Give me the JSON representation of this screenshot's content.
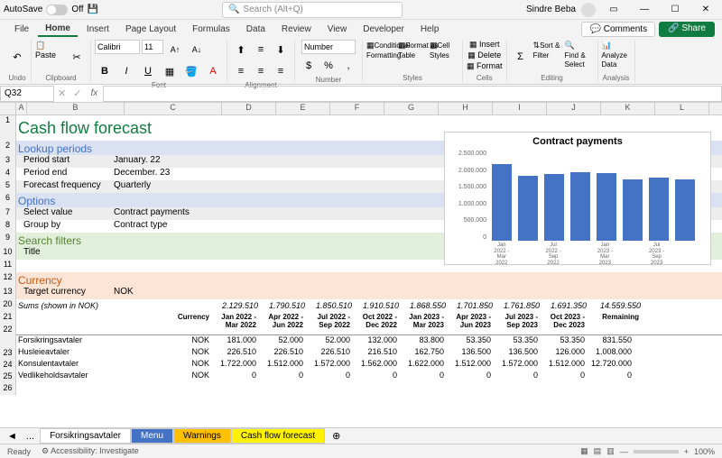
{
  "titlebar": {
    "autosave": "AutoSave",
    "off": "Off",
    "search": "Search (Alt+Q)",
    "user": "Sindre Beba"
  },
  "menu": {
    "file": "File",
    "home": "Home",
    "insert": "Insert",
    "pagelayout": "Page Layout",
    "formulas": "Formulas",
    "data": "Data",
    "review": "Review",
    "view": "View",
    "developer": "Developer",
    "help": "Help",
    "comments": "Comments",
    "share": "Share"
  },
  "ribbon": {
    "undo": "Undo",
    "clipboard": "Clipboard",
    "paste": "Paste",
    "font": "Font",
    "fontname": "Calibri",
    "fontsize": "11",
    "alignment": "Alignment",
    "number": "Number",
    "numfmt": "Number",
    "styles": "Styles",
    "condfmt": "Conditional\nFormatting",
    "fmttable": "Format as\nTable",
    "cellstyles": "Cell\nStyles",
    "cells": "Cells",
    "insert": "Insert",
    "delete": "Delete",
    "format": "Format",
    "editing": "Editing",
    "sort": "Sort &\nFilter",
    "find": "Find &\nSelect",
    "analysis": "Analysis",
    "analyze": "Analyze\nData"
  },
  "namebox": "Q32",
  "cols": [
    "A",
    "B",
    "C",
    "D",
    "E",
    "F",
    "G",
    "H",
    "I",
    "J",
    "K",
    "L"
  ],
  "sheet": {
    "title": "Cash flow forecast",
    "sec1": "Lookup periods",
    "period_start_lbl": "Period start",
    "period_start": "January. 22",
    "period_end_lbl": "Period end",
    "period_end": "December. 23",
    "freq_lbl": "Forecast frequency",
    "freq": "Quarterly",
    "sec2": "Options",
    "selval_lbl": "Select value",
    "selval": "Contract payments",
    "groupby_lbl": "Group by",
    "groupby": "Contract type",
    "sec3": "Search filters",
    "title_lbl": "Title",
    "sec4": "Currency",
    "curr_lbl": "Target currency",
    "curr": "NOK",
    "sums": "Sums (shown in NOK)",
    "currency_hdr": "Currency",
    "remaining_hdr": "Remaining",
    "periods": [
      "Jan 2022 - Mar 2022",
      "Apr 2022 - Jun 2022",
      "Jul 2022 - Sep 2022",
      "Oct 2022 - Dec 2022",
      "Jan 2023 - Mar 2023",
      "Apr 2023 - Jun 2023",
      "Jul 2023 - Sep 2023",
      "Oct 2023 - Dec 2023"
    ],
    "totals": [
      "2.129.510",
      "1.790.510",
      "1.850.510",
      "1.910.510",
      "1.868.550",
      "1.701.850",
      "1.761.850",
      "1.691.350",
      "14.559.550"
    ],
    "rows": [
      {
        "name": "Forsikringsavtaler",
        "cur": "NOK",
        "v": [
          "181.000",
          "52.000",
          "52.000",
          "132.000",
          "83.800",
          "53.350",
          "53.350",
          "53.350",
          "831.550"
        ]
      },
      {
        "name": "Husleieavtaler",
        "cur": "NOK",
        "v": [
          "226.510",
          "226.510",
          "226.510",
          "216.510",
          "162.750",
          "136.500",
          "136.500",
          "126.000",
          "1.008.000"
        ]
      },
      {
        "name": "Konsulentavtaler",
        "cur": "NOK",
        "v": [
          "1.722.000",
          "1.512.000",
          "1.572.000",
          "1.562.000",
          "1.622.000",
          "1.512.000",
          "1.572.000",
          "1.512.000",
          "12.720.000"
        ]
      },
      {
        "name": "Vedlikeholdsavtaler",
        "cur": "NOK",
        "v": [
          "0",
          "0",
          "0",
          "0",
          "0",
          "0",
          "0",
          "0",
          "0"
        ]
      }
    ]
  },
  "chart": {
    "title": "Contract payments",
    "ylabels": [
      "2.500.000",
      "2.000.000",
      "1.500.000",
      "1.000.000",
      "500.000",
      "0"
    ],
    "xlabels": [
      "Jan 2022 - Mar 2022",
      "",
      "Jul 2022 - Sep 2022",
      "",
      "Jan 2023 - Mar 2023",
      "",
      "Jul 2023 - Sep 2023",
      ""
    ]
  },
  "chart_data": {
    "type": "bar",
    "title": "Contract payments",
    "categories": [
      "Jan 2022 - Mar 2022",
      "Apr 2022 - Jun 2022",
      "Jul 2022 - Sep 2022",
      "Oct 2022 - Dec 2022",
      "Jan 2023 - Mar 2023",
      "Apr 2023 - Jun 2023",
      "Jul 2023 - Sep 2023",
      "Oct 2023 - Dec 2023"
    ],
    "values": [
      2129510,
      1790510,
      1850510,
      1910510,
      1868550,
      1701850,
      1761850,
      1691350
    ],
    "ylim": [
      0,
      2500000
    ],
    "xlabel": "",
    "ylabel": ""
  },
  "tabs": {
    "forsikring": "Forsikringsavtaler",
    "menu": "Menu",
    "warnings": "Warnings",
    "cashflow": "Cash flow forecast"
  },
  "status": {
    "ready": "Ready",
    "access": "Accessibility: Investigate",
    "zoom": "100%"
  }
}
